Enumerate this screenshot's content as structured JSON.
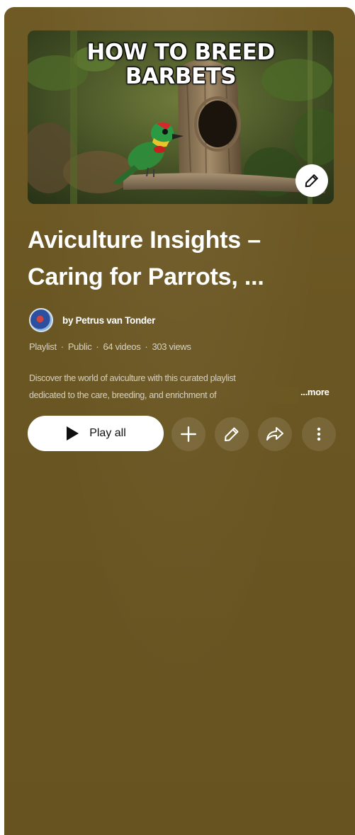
{
  "thumbnail": {
    "title_text": "HOW TO BREED BARBETS",
    "title_line1": "HOW TO BREED",
    "title_line2": "BARBETS"
  },
  "playlist": {
    "title_line1": "Aviculture Insights –",
    "title_line2": "Caring for Parrots, ...",
    "owner": "by Petrus van Tonder",
    "meta": {
      "type": "Playlist",
      "visibility": "Public",
      "videos": "64 videos",
      "views": "303 views",
      "separator": "·"
    },
    "description_line1": "Discover the world of aviculture with this curated playlist",
    "description_line2": "dedicated to the care, breeding, and enrichment of",
    "more_label": "...more"
  },
  "actions": {
    "play_all_label": "Play all"
  },
  "icons": {
    "edit_thumbnail": "pencil-icon",
    "play": "play-icon",
    "add": "plus-icon",
    "edit": "pencil-icon",
    "share": "share-icon",
    "more": "more-vertical-icon"
  },
  "colors": {
    "panel_background": "#6b5723",
    "text_primary": "#ffffff",
    "button_background": "#ffffff"
  }
}
